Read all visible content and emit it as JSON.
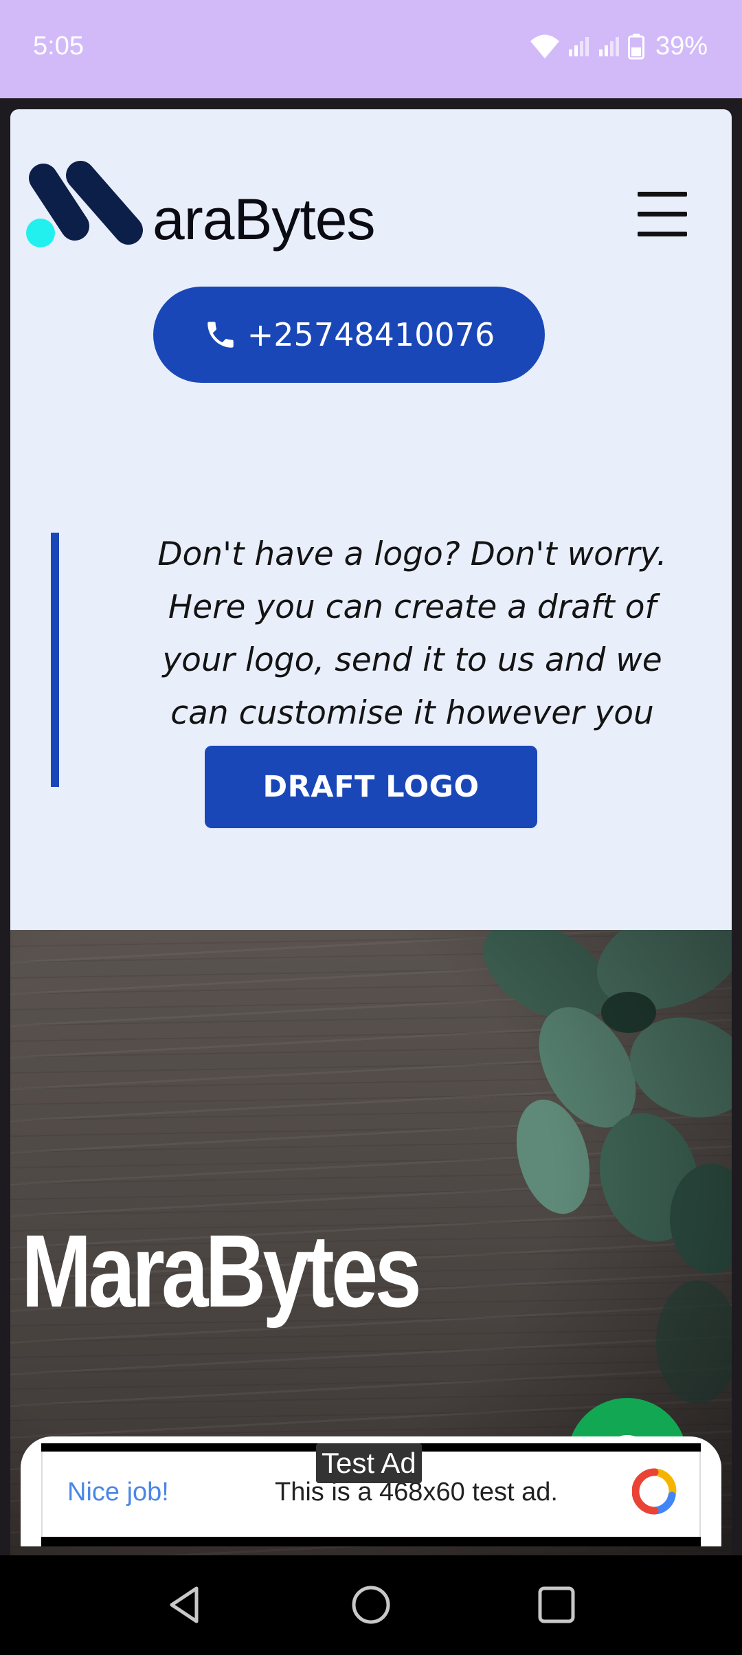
{
  "status_bar": {
    "time": "5:05",
    "battery_percent": "39%",
    "icons": [
      "wifi-icon",
      "signal-icon",
      "signal-icon",
      "battery-icon"
    ]
  },
  "header": {
    "logo_text": "araBytes",
    "menu_icon": "hamburger-menu-icon"
  },
  "contact": {
    "phone_number": "+25748410076",
    "icon": "phone-icon"
  },
  "quote": {
    "text": "Don't have a logo? Don't worry. Here you can create a draft of your logo, send it to us and we can customise it however you want"
  },
  "draft_button": {
    "label": "DRAFT LOGO"
  },
  "hero": {
    "title": "MaraBytes"
  },
  "chat_button": {
    "icon": "chat-icon"
  },
  "ad": {
    "label": "Test Ad",
    "headline": "Nice job!",
    "body": "This is a 468x60 test ad."
  },
  "nav_bar": {
    "items": [
      "back-icon",
      "home-icon",
      "recents-icon"
    ]
  },
  "colors": {
    "status_bar": "#d2baf9",
    "page_background": "#e9eefb",
    "accent_blue": "#1a47b8",
    "logo_cyan": "#22f0ee",
    "logo_navy": "#0c1f48",
    "chat_green": "#12a853"
  }
}
